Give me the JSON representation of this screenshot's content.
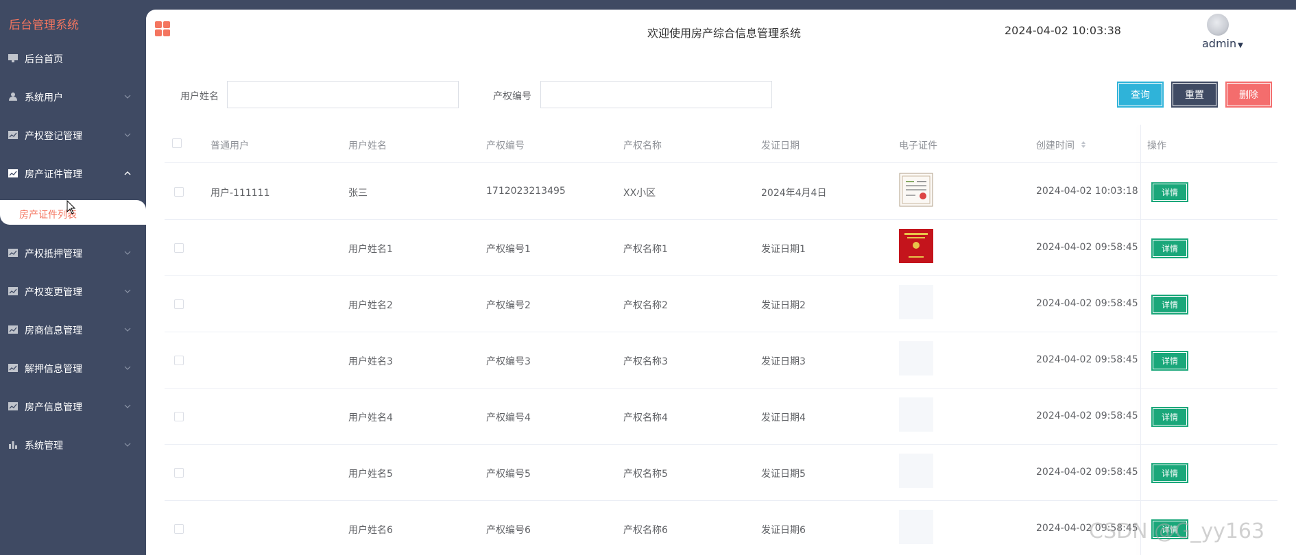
{
  "sidebar": {
    "brand": "后台管理系统",
    "items": [
      {
        "label": "后台首页",
        "icon": "monitor-icon",
        "has_chevron": false
      },
      {
        "label": "系统用户",
        "icon": "user-icon",
        "has_chevron": true
      },
      {
        "label": "产权登记管理",
        "icon": "chart-icon",
        "has_chevron": true
      },
      {
        "label": "房产证件管理",
        "icon": "chart-icon",
        "has_chevron": true,
        "expanded": true
      },
      {
        "label": "产权抵押管理",
        "icon": "chart-icon",
        "has_chevron": true
      },
      {
        "label": "产权变更管理",
        "icon": "chart-icon",
        "has_chevron": true
      },
      {
        "label": "房商信息管理",
        "icon": "chart-icon",
        "has_chevron": true
      },
      {
        "label": "解押信息管理",
        "icon": "chart-icon",
        "has_chevron": true
      },
      {
        "label": "房产信息管理",
        "icon": "chart-icon",
        "has_chevron": true
      },
      {
        "label": "系统管理",
        "icon": "bar-chart-icon",
        "has_chevron": true
      }
    ],
    "active_subitem": "房产证件列表"
  },
  "header": {
    "welcome": "欢迎使用房产综合信息管理系统",
    "datetime": "2024-04-02 10:03:38",
    "username": "admin"
  },
  "search": {
    "name_label": "用户姓名",
    "name_value": "",
    "code_label": "产权编号",
    "code_value": "",
    "query_label": "查询",
    "reset_label": "重置",
    "delete_label": "删除"
  },
  "table": {
    "columns": [
      "普通用户",
      "用户姓名",
      "产权编号",
      "产权名称",
      "发证日期",
      "电子证件",
      "创建时间",
      "操作"
    ],
    "detail_label": "详情",
    "rows": [
      {
        "user": "用户-111111",
        "name": "张三",
        "code": "1712023213495",
        "title": "XX小区",
        "date": "2024年4月4日",
        "thumb": "certificate-white",
        "created": "2024-04-02 10:03:18"
      },
      {
        "user": "",
        "name": "用户姓名1",
        "code": "产权编号1",
        "title": "产权名称1",
        "date": "发证日期1",
        "thumb": "certificate-red",
        "created": "2024-04-02 09:58:45"
      },
      {
        "user": "",
        "name": "用户姓名2",
        "code": "产权编号2",
        "title": "产权名称2",
        "date": "发证日期2",
        "thumb": "empty",
        "created": "2024-04-02 09:58:45"
      },
      {
        "user": "",
        "name": "用户姓名3",
        "code": "产权编号3",
        "title": "产权名称3",
        "date": "发证日期3",
        "thumb": "empty",
        "created": "2024-04-02 09:58:45"
      },
      {
        "user": "",
        "name": "用户姓名4",
        "code": "产权编号4",
        "title": "产权名称4",
        "date": "发证日期4",
        "thumb": "empty",
        "created": "2024-04-02 09:58:45"
      },
      {
        "user": "",
        "name": "用户姓名5",
        "code": "产权编号5",
        "title": "产权名称5",
        "date": "发证日期5",
        "thumb": "empty",
        "created": "2024-04-02 09:58:45"
      },
      {
        "user": "",
        "name": "用户姓名6",
        "code": "产权编号6",
        "title": "产权名称6",
        "date": "发证日期6",
        "thumb": "empty",
        "created": "2024-04-02 09:58:45"
      }
    ]
  },
  "watermark": "CSDN @G_yy163",
  "colors": {
    "sidebar_bg": "#3f4a63",
    "accent": "#f4755f",
    "query": "#2fb3d9",
    "delete": "#f46d6d",
    "detail": "#1aa77a"
  }
}
